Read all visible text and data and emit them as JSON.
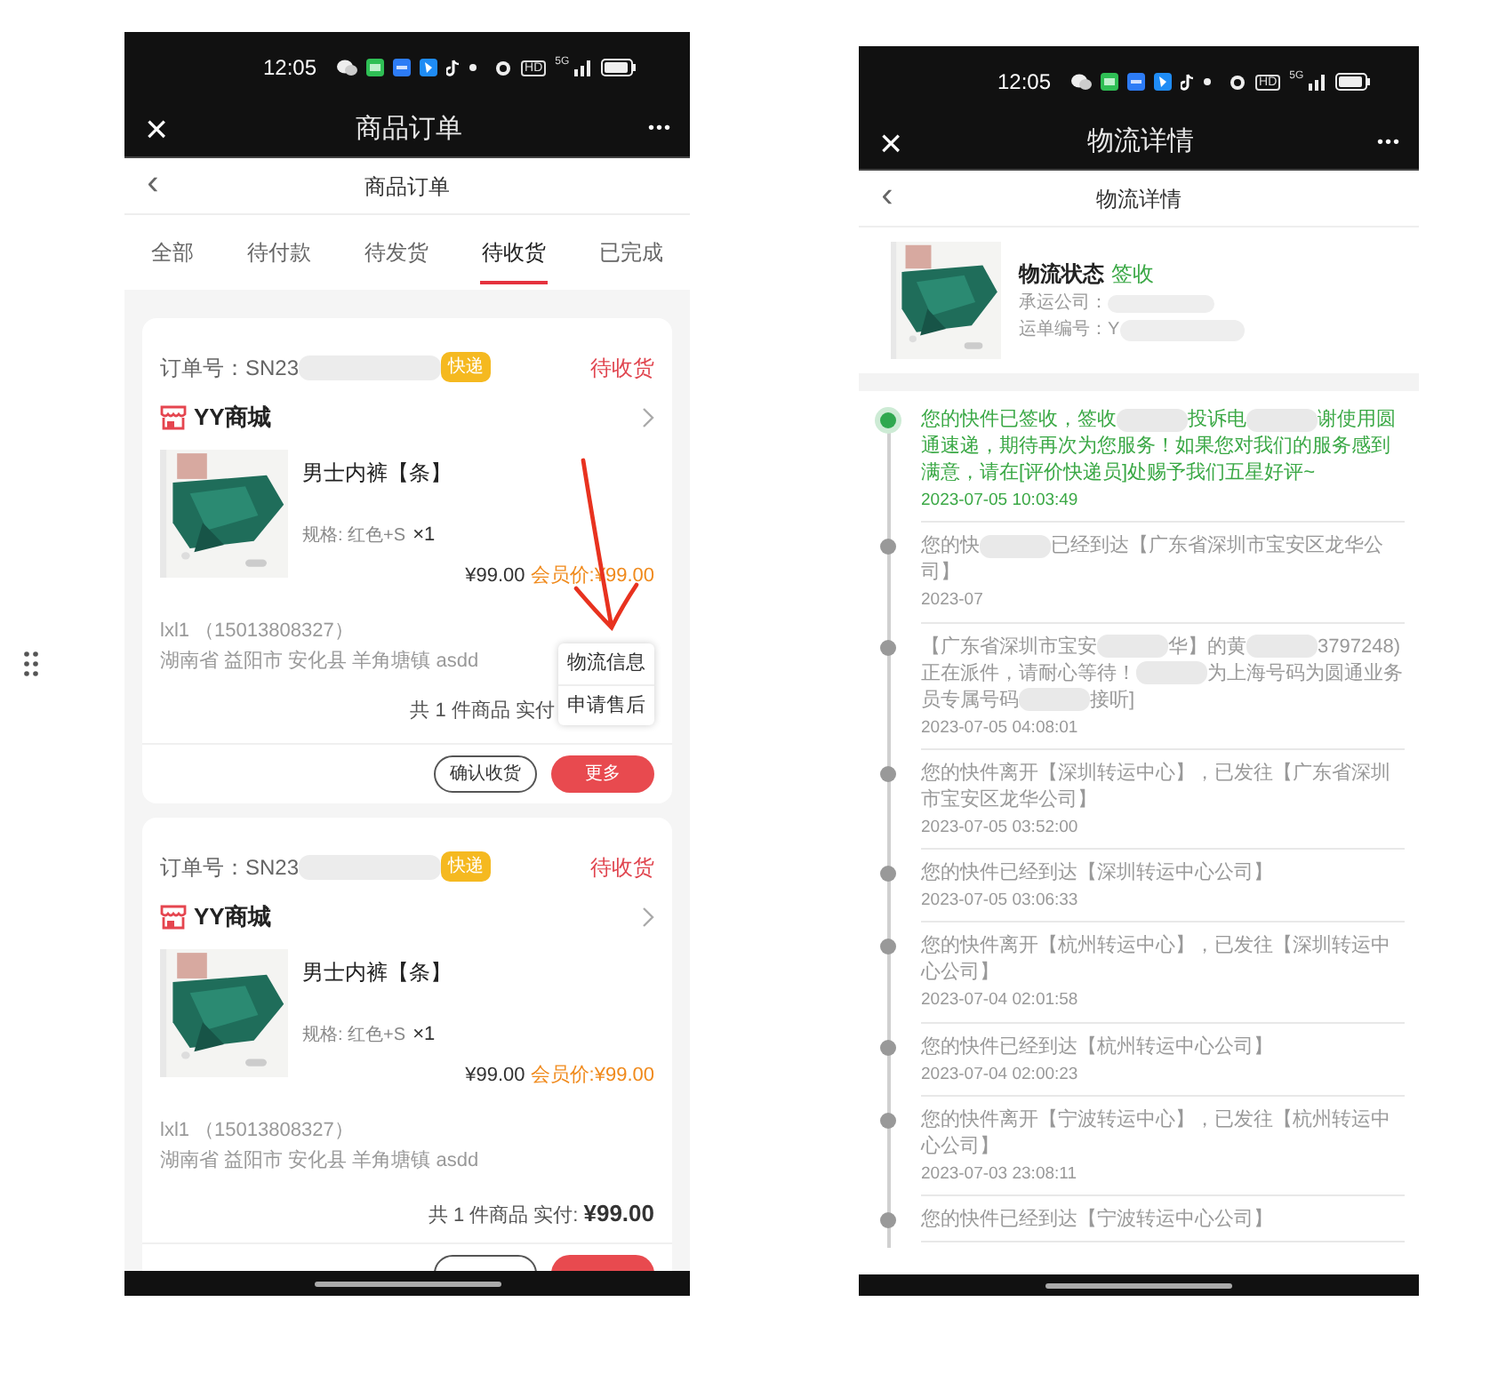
{
  "orders_screen": {
    "status_bar": {
      "time": "12:05",
      "hd": "HD",
      "network": "5G"
    },
    "title_bar": {
      "title": "商品订单",
      "close": "×",
      "more": "•••"
    },
    "header": {
      "back": "‹",
      "title": "商品订单"
    },
    "tabs": [
      {
        "label": "全部",
        "selected": false
      },
      {
        "label": "待付款",
        "selected": false
      },
      {
        "label": "待发货",
        "selected": false
      },
      {
        "label": "待收货",
        "selected": true
      },
      {
        "label": "已完成",
        "selected": false
      }
    ],
    "orders": [
      {
        "order_no": "订单号：SN23",
        "badge": "快递",
        "status": "待收货",
        "shop": "YY商城",
        "product": "男士内裤【条】",
        "spec": "规格: 红色+S",
        "qty": "×1",
        "price": "¥99.00",
        "member_price": "会员价:¥99.00",
        "receiver": "lxl1 （15013808327）",
        "address": "湖南省 益阳市 安化县 羊角塘镇 asdd",
        "total_label": "共 1 件商品 实付",
        "buttons": [
          {
            "label": "确认收货",
            "kind": "outline"
          },
          {
            "label": "更多",
            "kind": "primary"
          }
        ],
        "menu": [
          "物流信息",
          "申请售后"
        ]
      },
      {
        "order_no": "订单号：SN23",
        "badge": "快递",
        "status": "待收货",
        "shop": "YY商城",
        "product": "男士内裤【条】",
        "spec": "规格: 红色+S",
        "qty": "×1",
        "price": "¥99.00",
        "member_price": "会员价:¥99.00",
        "receiver": "lxl1 （15013808327）",
        "address": "湖南省 益阳市 安化县 羊角塘镇 asdd",
        "total_label": "共 1 件商品 实付:",
        "total": "¥99.00",
        "buttons": [
          {
            "kind": "outline"
          },
          {
            "kind": "primary"
          }
        ]
      }
    ]
  },
  "logistics_screen": {
    "status_bar": {
      "time": "12:05",
      "hd": "HD",
      "network": "5G"
    },
    "title_bar": {
      "title": "物流详情",
      "close": "×",
      "more": "•••"
    },
    "header": {
      "back": "‹",
      "title": "物流详情"
    },
    "summary": {
      "label": "物流状态",
      "status": "签收",
      "carrier": "承运公司：",
      "tracking": "运单编号：Y"
    },
    "events": [
      {
        "latest": true,
        "segments": [
          {
            "kind": "text",
            "text": "您的快件已签收，签收"
          },
          {
            "kind": "redacted"
          },
          {
            "kind": "text",
            "text": "投诉电"
          },
          {
            "kind": "redacted"
          },
          {
            "kind": "text",
            "text": "谢使用圆通速递，期待再次为您服务！如果您对我们的服务感到满意，请在[评价快递员]处赐予我们五星好评~"
          }
        ],
        "time": "2023-07-05 10:03:49"
      },
      {
        "latest": false,
        "segments": [
          {
            "kind": "text",
            "text": "您的快"
          },
          {
            "kind": "redacted"
          },
          {
            "kind": "text",
            "text": "已经到达【广东省深圳市宝安区龙华公司】"
          }
        ],
        "time": "2023-07"
      },
      {
        "latest": false,
        "segments": [
          {
            "kind": "text",
            "text": "【广东省深圳市宝安"
          },
          {
            "kind": "redacted"
          },
          {
            "kind": "text",
            "text": "华】的黄"
          },
          {
            "kind": "redacted"
          },
          {
            "kind": "text",
            "text": "3797248)正在派件，请耐心等待！"
          },
          {
            "kind": "redacted"
          },
          {
            "kind": "text",
            "text": "为上海号码为圆通业务员专属号码"
          },
          {
            "kind": "redacted"
          },
          {
            "kind": "text",
            "text": "接听]"
          }
        ],
        "time": "2023-07-05 04:08:01"
      },
      {
        "latest": false,
        "segments": [
          {
            "kind": "text",
            "text": "您的快件离开【深圳转运中心】，已发往【广东省深圳市宝安区龙华公司】"
          }
        ],
        "time": "2023-07-05 03:52:00"
      },
      {
        "latest": false,
        "segments": [
          {
            "kind": "text",
            "text": "您的快件已经到达【深圳转运中心公司】"
          }
        ],
        "time": "2023-07-05 03:06:33"
      },
      {
        "latest": false,
        "segments": [
          {
            "kind": "text",
            "text": "您的快件离开【杭州转运中心】，已发往【深圳转运中心公司】"
          }
        ],
        "time": "2023-07-04 02:01:58"
      },
      {
        "latest": false,
        "segments": [
          {
            "kind": "text",
            "text": "您的快件已经到达【杭州转运中心公司】"
          }
        ],
        "time": "2023-07-04 02:00:23"
      },
      {
        "latest": false,
        "segments": [
          {
            "kind": "text",
            "text": "您的快件离开【宁波转运中心】，已发往【杭州转运中心公司】"
          }
        ],
        "time": "2023-07-03 23:08:11"
      },
      {
        "latest": false,
        "segments": [
          {
            "kind": "text",
            "text": "您的快件已经到达【宁波转运中心公司】"
          }
        ]
      }
    ]
  }
}
